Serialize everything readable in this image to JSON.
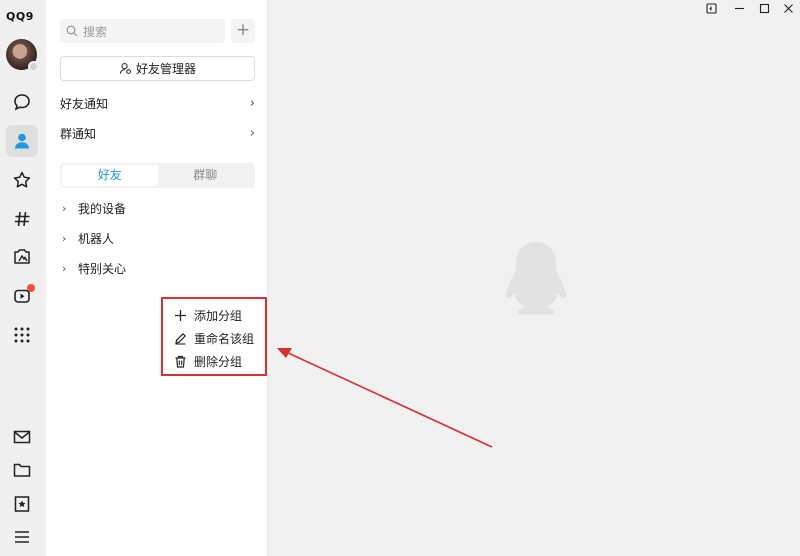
{
  "app": {
    "logo_text": "QQ9"
  },
  "search": {
    "placeholder": "搜索",
    "add_label": "+"
  },
  "friend_manager": {
    "label": "好友管理器"
  },
  "notices": [
    {
      "label": "好友通知",
      "chevron": "›"
    },
    {
      "label": "群通知",
      "chevron": "›"
    }
  ],
  "tabs": [
    {
      "label": "好友",
      "active": true
    },
    {
      "label": "群聊",
      "active": false
    }
  ],
  "groups": [
    {
      "label": "我的设备",
      "arrow": "›"
    },
    {
      "label": "机器人",
      "arrow": "›"
    },
    {
      "label": "特别关心",
      "arrow": "›"
    }
  ],
  "context_menu": {
    "items": [
      {
        "label": "添加分组",
        "icon": "plus-icon"
      },
      {
        "label": "重命名该组",
        "icon": "pencil-icon"
      },
      {
        "label": "删除分组",
        "icon": "trash-icon"
      }
    ]
  },
  "sidebar_icons": [
    "chat-icon",
    "contacts-icon",
    "star-icon",
    "hash-icon",
    "photo-icon",
    "video-icon",
    "apps-grid-icon",
    "mail-icon",
    "folder-icon",
    "bookmark-icon",
    "menu-icon"
  ],
  "window_controls": [
    "pin-icon",
    "minimize-icon",
    "maximize-icon",
    "close-icon"
  ],
  "colors": {
    "accent": "#1e9ae0",
    "annotation": "#d93030",
    "badge": "#f0503c"
  }
}
